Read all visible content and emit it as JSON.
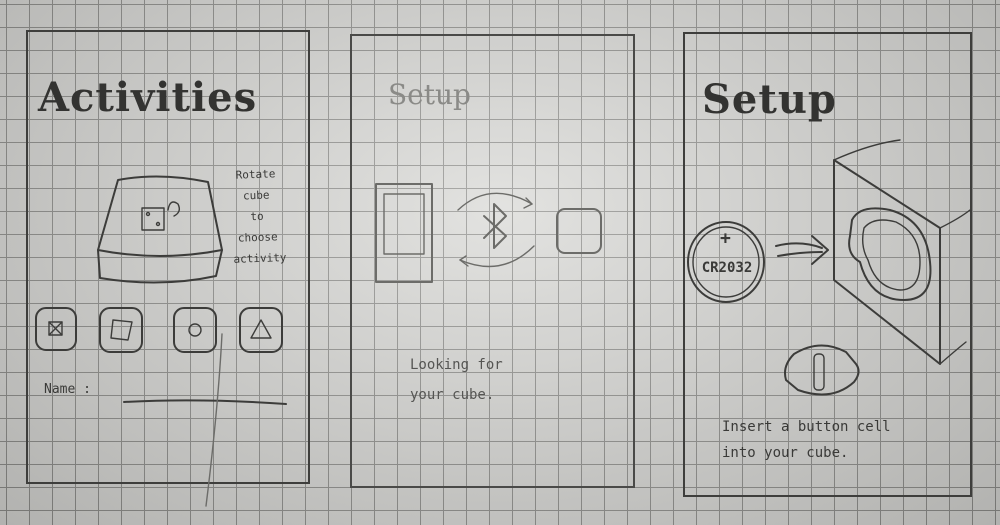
{
  "activities": {
    "title": "Activities",
    "hint_lines": [
      "Rotate",
      "cube",
      "to",
      "choose",
      "activity"
    ],
    "name_label": "Name :"
  },
  "setup_bluetooth": {
    "title": "Setup",
    "status_lines": [
      "Looking for",
      "your cube."
    ]
  },
  "setup_battery": {
    "title": "Setup",
    "battery_label": "CR2032",
    "battery_sign": "+",
    "instruction_lines": [
      "Insert a button cell",
      "into your cube."
    ]
  }
}
